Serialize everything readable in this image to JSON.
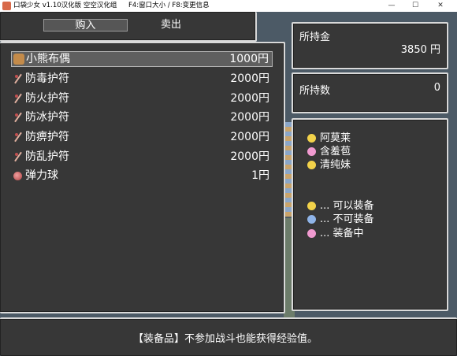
{
  "window": {
    "title": "口袋少女 v1.10汉化版  空空汉化组",
    "hint": "F4:窗口大小 / F8:变更信息",
    "min": "—",
    "max": "☐",
    "close": "✕"
  },
  "shop": {
    "tabs": {
      "buy": "购入",
      "sell": "卖出"
    },
    "items": [
      {
        "name": "小熊布偶",
        "price": "1000円",
        "icon": "doll-icon"
      },
      {
        "name": "防毒护符",
        "price": "2000円",
        "icon": "charm-icon"
      },
      {
        "name": "防火护符",
        "price": "2000円",
        "icon": "charm-icon"
      },
      {
        "name": "防冰护符",
        "price": "2000円",
        "icon": "charm-icon"
      },
      {
        "name": "防痹护符",
        "price": "2000円",
        "icon": "charm-icon"
      },
      {
        "name": "防乱护符",
        "price": "2000円",
        "icon": "charm-icon"
      },
      {
        "name": "弹力球",
        "price": "1円",
        "icon": "ball-icon"
      }
    ],
    "money_label": "所持金",
    "money_value": "3850 円",
    "count_label": "所持数",
    "count_value": "0"
  },
  "party": {
    "members": [
      {
        "name": "阿莫莱",
        "status": "equippable"
      },
      {
        "name": "含羞苞",
        "status": "equipped"
      },
      {
        "name": "清纯妹",
        "status": "equippable"
      }
    ],
    "legend": [
      {
        "text": "... 可以装备",
        "status": "equippable"
      },
      {
        "text": "... 不可装备",
        "status": "not-equippable"
      },
      {
        "text": "... 装备中",
        "status": "equipped"
      }
    ]
  },
  "help": {
    "text": "【装备品】不参加战斗也能获得经验值。"
  }
}
